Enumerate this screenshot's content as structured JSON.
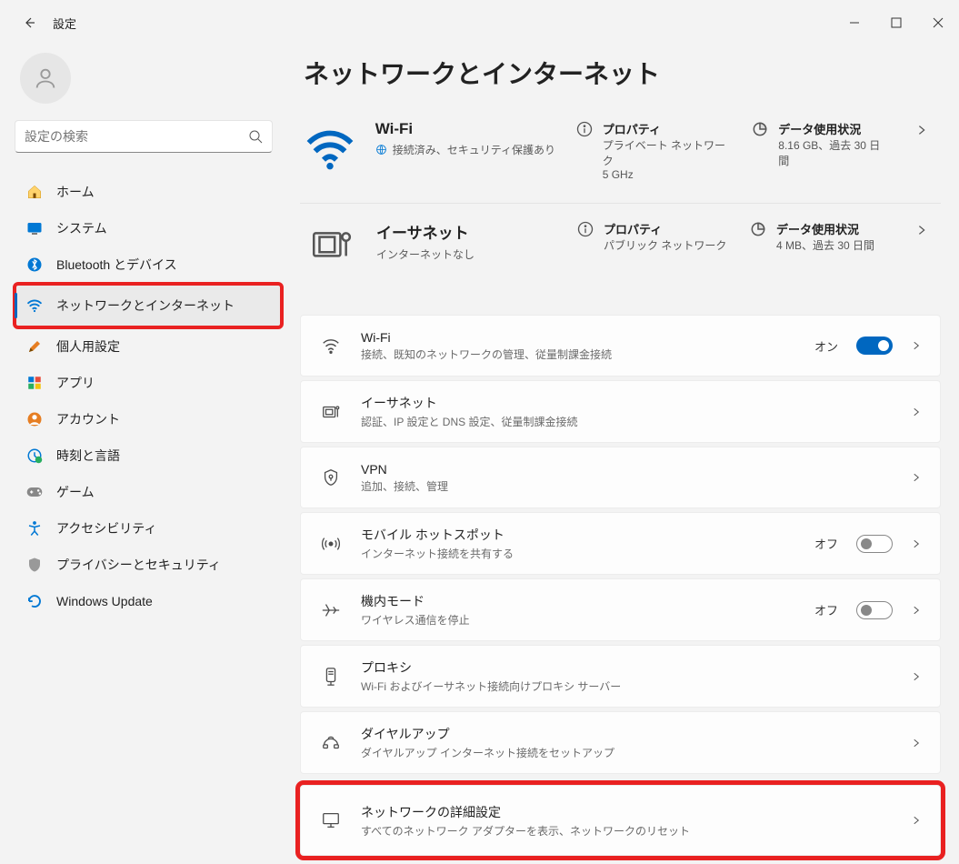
{
  "window": {
    "title": "設定"
  },
  "search": {
    "placeholder": "設定の検索"
  },
  "sidebar": {
    "items": [
      {
        "label": "ホーム"
      },
      {
        "label": "システム"
      },
      {
        "label": "Bluetooth とデバイス"
      },
      {
        "label": "ネットワークとインターネット"
      },
      {
        "label": "個人用設定"
      },
      {
        "label": "アプリ"
      },
      {
        "label": "アカウント"
      },
      {
        "label": "時刻と言語"
      },
      {
        "label": "ゲーム"
      },
      {
        "label": "アクセシビリティ"
      },
      {
        "label": "プライバシーとセキュリティ"
      },
      {
        "label": "Windows Update"
      }
    ]
  },
  "main": {
    "title": "ネットワークとインターネット",
    "wifi_status": {
      "name": "Wi-Fi",
      "sub": "接続済み、セキュリティ保護あり",
      "prop_label": "プロパティ",
      "prop_sub1": "プライベート ネットワーク",
      "prop_sub2": "5 GHz",
      "usage_label": "データ使用状況",
      "usage_sub": "8.16 GB、過去 30 日間"
    },
    "eth_status": {
      "name": "イーサネット",
      "sub": "インターネットなし",
      "prop_label": "プロパティ",
      "prop_sub1": "パブリック ネットワーク",
      "usage_label": "データ使用状況",
      "usage_sub": "4 MB、過去 30 日間"
    },
    "rows": {
      "wifi": {
        "title": "Wi-Fi",
        "desc": "接続、既知のネットワークの管理、従量制課金接続",
        "state": "オン"
      },
      "eth": {
        "title": "イーサネット",
        "desc": "認証、IP 設定と DNS 設定、従量制課金接続"
      },
      "vpn": {
        "title": "VPN",
        "desc": "追加、接続、管理"
      },
      "hotspot": {
        "title": "モバイル ホットスポット",
        "desc": "インターネット接続を共有する",
        "state": "オフ"
      },
      "airplane": {
        "title": "機内モード",
        "desc": "ワイヤレス通信を停止",
        "state": "オフ"
      },
      "proxy": {
        "title": "プロキシ",
        "desc": "Wi-Fi およびイーサネット接続向けプロキシ サーバー"
      },
      "dialup": {
        "title": "ダイヤルアップ",
        "desc": "ダイヤルアップ インターネット接続をセットアップ"
      },
      "advanced": {
        "title": "ネットワークの詳細設定",
        "desc": "すべてのネットワーク アダプターを表示、ネットワークのリセット"
      }
    }
  }
}
